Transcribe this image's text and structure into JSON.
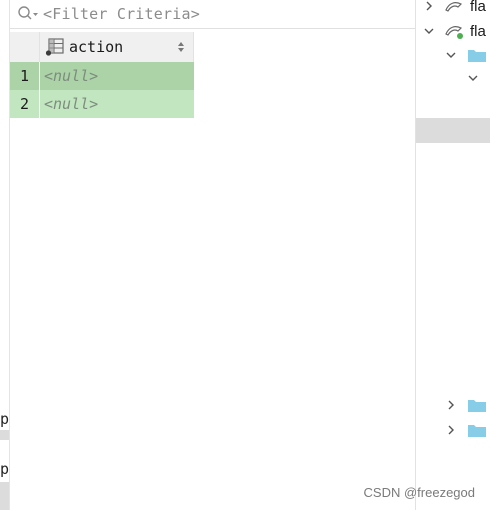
{
  "filter": {
    "placeholder": "<Filter Criteria>",
    "icon": "search-filter-icon"
  },
  "grid": {
    "columns": [
      {
        "name": "action",
        "icon": "column-table-icon",
        "sort_icon": "sort-arrows-icon"
      }
    ],
    "rows": [
      {
        "num": "1",
        "action": "<null>"
      },
      {
        "num": "2",
        "action": "<null>"
      }
    ]
  },
  "tree": {
    "nodes": [
      {
        "label": "fla",
        "expanded": false,
        "icon": "dolphin-db-icon"
      },
      {
        "label": "fla",
        "expanded": true,
        "icon": "dolphin-db-connected-icon"
      },
      {
        "label": "",
        "expanded": true,
        "icon": "folder-icon"
      },
      {
        "label": "",
        "expanded": true,
        "icon": "chevron-down-icon"
      },
      {
        "label": "",
        "expanded": false,
        "icon": "folder-icon"
      },
      {
        "label": "",
        "expanded": false,
        "icon": "folder-icon"
      }
    ]
  },
  "edge_stubs": {
    "stub1": "p",
    "stub2": "p"
  },
  "watermark": "CSDN @freezegod",
  "colors": {
    "selected_row": "#acd3a8",
    "row": "#c1e6c0",
    "folder": "#87cde8",
    "connected_dot": "#4caf50"
  }
}
